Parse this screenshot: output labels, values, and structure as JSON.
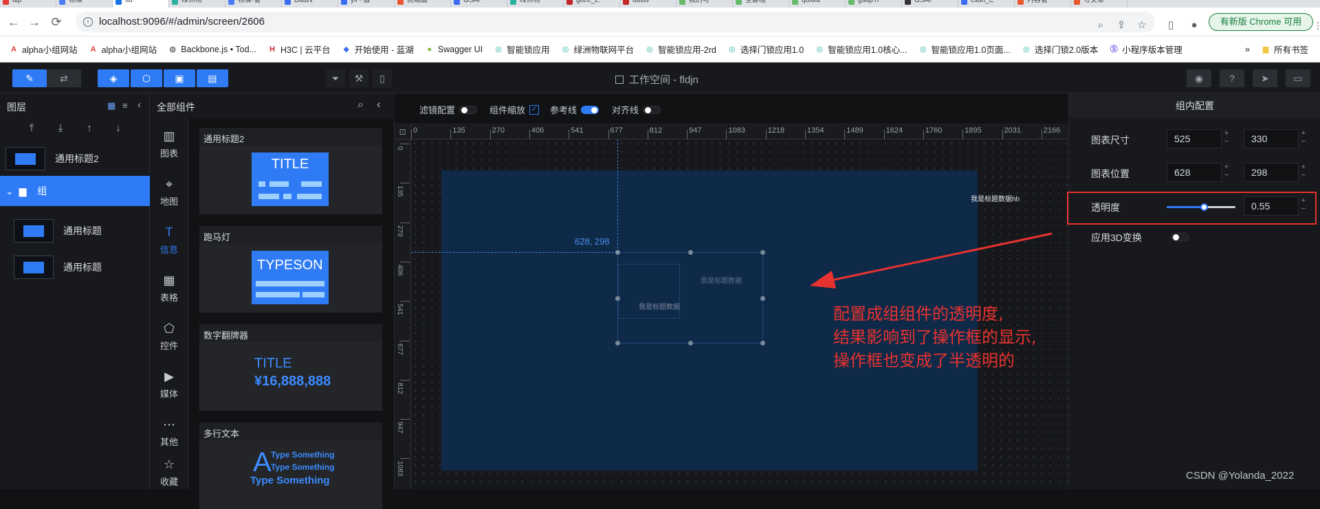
{
  "browser": {
    "tabs": [
      {
        "label": "alp",
        "color": "#e53935"
      },
      {
        "label": "标准",
        "color": "#4a7cf5"
      },
      {
        "label": "fld",
        "color": "#1a73e8",
        "active": true
      },
      {
        "label": "绿洲物",
        "color": "#2bb3a0"
      },
      {
        "label": "标准-管",
        "color": "#4a7cf5"
      },
      {
        "label": "DataV",
        "color": "#3b6cf5"
      },
      {
        "label": "yii - 服",
        "color": "#3b6cf5"
      },
      {
        "label": "前端面",
        "color": "#e8572f"
      },
      {
        "label": "GSAP",
        "color": "#3b6cf5"
      },
      {
        "label": "绿洲物",
        "color": "#2bb3a0"
      },
      {
        "label": "gitee_E",
        "color": "#c62828"
      },
      {
        "label": "datav",
        "color": "#c62828"
      },
      {
        "label": "我的可",
        "color": "#66bb6a"
      },
      {
        "label": "全部组",
        "color": "#66bb6a"
      },
      {
        "label": "quxka",
        "color": "#66bb6a"
      },
      {
        "label": "gsap.h",
        "color": "#66bb6a"
      },
      {
        "label": "GSAP",
        "color": "#333333"
      },
      {
        "label": "csdn_E",
        "color": "#3b6cf5"
      },
      {
        "label": "内容管",
        "color": "#e8572f"
      },
      {
        "label": "写文章",
        "color": "#e8572f"
      }
    ],
    "url": "localhost:9096/#/admin/screen/2606",
    "update_label": "有新版 Chrome 可用",
    "bookmarks": [
      {
        "label": "alpha小组网站",
        "icon": "A",
        "color": "#e53935"
      },
      {
        "label": "alpha小组网站",
        "icon": "A",
        "color": "#e53935"
      },
      {
        "label": "Backbone.js • Tod...",
        "icon": "◍",
        "color": "#333333"
      },
      {
        "label": "H3C | 云平台",
        "icon": "H",
        "color": "#c62828"
      },
      {
        "label": "开始使用 - 蓝湖",
        "icon": "◆",
        "color": "#3b6cf5"
      },
      {
        "label": "Swagger UI",
        "icon": "●",
        "color": "#7cb342"
      },
      {
        "label": "智能锁应用",
        "icon": "◎",
        "color": "#2bb3a0"
      },
      {
        "label": "绿洲物联网平台",
        "icon": "◎",
        "color": "#2bb3a0"
      },
      {
        "label": "智能锁应用-2rd",
        "icon": "◎",
        "color": "#2bb3a0"
      },
      {
        "label": "选择门锁应用1.0",
        "icon": "◎",
        "color": "#2bb3a0"
      },
      {
        "label": "智能锁应用1.0核心...",
        "icon": "◎",
        "color": "#2bb3a0"
      },
      {
        "label": "智能锁应用1.0页面...",
        "icon": "◎",
        "color": "#2bb3a0"
      },
      {
        "label": "选择门锁2.0版本",
        "icon": "◎",
        "color": "#2bb3a0"
      },
      {
        "label": "小程序版本管理",
        "icon": "Ⓢ",
        "color": "#6a4fe0"
      }
    ],
    "bookmarks_more": "»",
    "all_bookmarks": "所有书签"
  },
  "header": {
    "workspace_title": "工作空间 - fldjn"
  },
  "layers": {
    "title": "图层",
    "items": [
      {
        "label": "通用标题2"
      },
      {
        "label": "组"
      },
      {
        "label": "通用标题"
      },
      {
        "label": "通用标题"
      }
    ]
  },
  "categories": [
    "图表",
    "地图",
    "信息",
    "表格",
    "控件",
    "媒体",
    "其他",
    "收藏"
  ],
  "components": {
    "title": "全部组件",
    "cards": [
      {
        "label": "通用标题2",
        "preview": "TITLE"
      },
      {
        "label": "跑马灯",
        "preview": "TYPESON"
      },
      {
        "label": "数字翻牌器",
        "preview": "TITLE",
        "number": "¥16,888,888"
      },
      {
        "label": "多行文本",
        "preview": "A",
        "lines": [
          "Type Something",
          "Type Something",
          "Type Something"
        ]
      }
    ]
  },
  "canvas": {
    "toggles": [
      {
        "label": "滤镜配置",
        "on": false,
        "kind": "switch"
      },
      {
        "label": "组件缩放",
        "on": true,
        "kind": "checkbox"
      },
      {
        "label": "参考线",
        "on": true,
        "kind": "switch"
      },
      {
        "label": "对齐线",
        "on": false,
        "kind": "switch"
      }
    ],
    "ruler_ticks": [
      "0",
      "135",
      "270",
      "406",
      "541",
      "677",
      "812",
      "947",
      "1083",
      "1218",
      "1354",
      "1489",
      "1624",
      "1760",
      "1895",
      "2031",
      "2166"
    ],
    "vruler_ticks": [
      "0",
      "135",
      "270",
      "406",
      "541",
      "677",
      "812",
      "947",
      "1083"
    ],
    "position_readout": "628, 298",
    "group_text_1": "我是标题数据",
    "group_text_2": "我是标题数据",
    "outer_text": "我是标题数据hh"
  },
  "inspector": {
    "title": "组内配置",
    "size_label": "图表尺寸",
    "width": "525",
    "height": "330",
    "pos_label": "图表位置",
    "x": "628",
    "y": "298",
    "opacity_label": "透明度",
    "opacity": "0.55",
    "opacity_value": 0.55,
    "transform_label": "应用3D变换",
    "transform_on": false
  },
  "annotation": {
    "lines": [
      "配置成组组件的透明度,",
      "结果影响到了操作框的显示,",
      "操作框也变成了半透明的"
    ]
  },
  "watermark": "CSDN @Yolanda_2022",
  "colors": {
    "accent": "#2f7bf5",
    "annotation": "#e8322f",
    "screen": "#0f2a48"
  }
}
